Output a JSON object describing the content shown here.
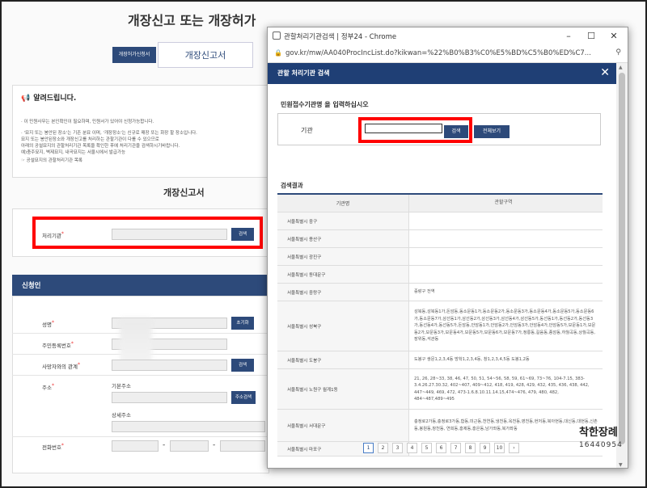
{
  "bg": {
    "title": "개장신고 또는 개장허가",
    "tab_permit": "개장허가신청서",
    "tab_report": "개장신고서",
    "notice_title": "알려드립니다.",
    "notice_lines": [
      "· 이 민원사무는 본인확인이 필요하며, 민원서가 있어야 신청가능합니다.",
      "· '묘지 또는 봉안된 장소'는 기존 분묘 이며, '개장장소'는 신규로 매장 또는 화장 할 장소입니다.",
      "  묘지 또는 봉안된장소와 개장신고를 처리하는 관할기관이 다를 수 있으므로",
      "  아래의 공설묘지의 관할처리기관 목록을 확인한 후에 처리기관을 검색하시기바랍니다.",
      "  예)충주묘지, 벽제묘지, 내곡묘지는 서울시에서 발급가능",
      "  ☞ 공설묘지의 관할처리기관 목록"
    ],
    "section_title": "개장신고서",
    "field_agency": "처리기관",
    "search_btn": "검색",
    "applicant_bar": "신청인",
    "name_label": "성명",
    "reset_btn": "초기화",
    "rrn_label": "주민등록번호",
    "relation_label": "사망자와의 관계",
    "relation_btn": "검색",
    "address_label": "주소",
    "basic_address": "기본주소",
    "address_btn": "주소검색",
    "detail_address": "상세주소",
    "phone_label": "전화번호",
    "phone_dash": "-"
  },
  "popup": {
    "window_title": "관할처리기관검색 | 정부24 - Chrome",
    "url": "gov.kr/mw/AA040ProcIncList.do?kikwan=%22%B0%B3%C0%E5%BD%C5%B0%ED%C7...",
    "dialog_title": "관할 처리기관 검색",
    "close": "✕",
    "instruction": "민원접수기관명 을 입력하십시오",
    "agency_label": "기관",
    "search_btn": "검색",
    "view_all_btn": "전체보기",
    "results_label": "검색결과",
    "col_agency": "기관명",
    "col_area": "관할구역",
    "rows": [
      {
        "agency": "서울특별시 중구",
        "area": ""
      },
      {
        "agency": "서울특별시 용산구",
        "area": ""
      },
      {
        "agency": "서울특별시 광진구",
        "area": ""
      },
      {
        "agency": "서울특별시 동대문구",
        "area": ""
      },
      {
        "agency": "서울특별시 중랑구",
        "area": "중랑구 전역"
      },
      {
        "agency": "서울특별시 성북구",
        "area": "성북동,성북동1가,돈암동,동소문동1가,동소문동2가,동소문동3가,동소문동4가,동소문동5가,동소문동6가,동소문동7가,삼선동1가,삼선동2가,삼선동3가,삼선동4가,삼선동5가,동선동1가,동선동2가,동선동3가,동선동4가,동선동5가,돈암동,안암동1가,안암동2가,안암동3가,안암동4가,안암동5가,보문동1가,보문동2가,보문동3가,보문동4가,보문동5가,보문동6가,보문동7가,정릉동,길음동,종암동,하월곡동,상월곡동,장위동,석관동"
      },
      {
        "agency": "서울특별시 도봉구",
        "area": "도봉구 쌍문1,2,3,4동 방학1,2,3,4동, 창1,2,3,4,5동 도봉1,2동"
      },
      {
        "agency": "서울특별시 노원구 월계1동",
        "area": "21, 26, 28~33, 38, 46, 47, 50, 51, 54~56, 58, 59, 61~69, 73~76, 104-7.15, 383-3.4.26.27.30.32, 402~407, 409~412, 418, 419, 428, 429, 432, 435, 436, 438, 442, 447~449, 469, 472, 473-1.6.8.10.11.14.15,474~476, 479, 480, 482, 484~487,489~495"
      },
      {
        "agency": "서울특별시 서대문구",
        "area": "충정로2가동,충정로3가동,합동,미근동,천연동,냉천동,옥천동,영천동,현저동,북아현동,대신동,대현동,신촌동,봉원동,창천동, 연희동,홍제동,홍은동,남가좌동,북가좌동"
      },
      {
        "agency": "서울특별시 마포구",
        "area": ""
      }
    ],
    "pages": [
      "1",
      "2",
      "3",
      "4",
      "5",
      "6",
      "7",
      "8",
      "9",
      "10",
      "›"
    ]
  },
  "brand": {
    "name": "착한장례",
    "phone": "16440954"
  },
  "colors": {
    "navy": "#2d4a7a",
    "dialog": "#1f3f75",
    "highlight": "#ff0000"
  }
}
